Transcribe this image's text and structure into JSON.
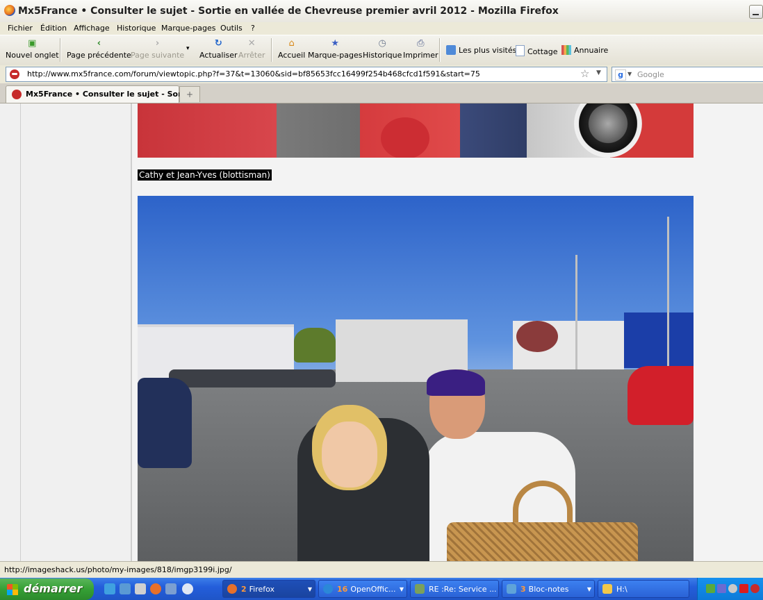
{
  "window": {
    "title": "Mx5France • Consulter le sujet - Sortie en vallée de Chevreuse premier avril 2012 - Mozilla Firefox"
  },
  "menu": [
    "Fichier",
    "Édition",
    "Affichage",
    "Historique",
    "Marque-pages",
    "Outils",
    "?"
  ],
  "toolbar": {
    "new_tab": "Nouvel onglet",
    "back": "Page précédente",
    "forward": "Page suivante",
    "reload": "Actualiser",
    "stop": "Arrêter",
    "home": "Accueil",
    "bookmarks": "Marque-pages",
    "history": "Historique",
    "print": "Imprimer"
  },
  "bookmarks_bar": [
    "Les plus visités",
    "Cottage",
    "Annuaire"
  ],
  "address": {
    "url": "http://www.mx5france.com/forum/viewtopic.php?f=37&t=13060&sid=bf85653fcc16499f254b468cfcd1f591&start=75"
  },
  "search": {
    "placeholder": "Google",
    "engine_icon": "g"
  },
  "tabs": [
    {
      "label": "Mx5France • Consulter le sujet - Sor..."
    }
  ],
  "new_tab_glyph": "+",
  "content": {
    "caption": "Cathy et Jean-Yves (blottisman)"
  },
  "status": {
    "text": "http://imageshack.us/photo/my-images/818/imgp3199i.jpg/"
  },
  "taskbar": {
    "start": "démarrer",
    "tasks": [
      {
        "num": "2",
        "label": "Firefox",
        "color": "#e8702a"
      },
      {
        "num": "16",
        "label": "OpenOffic...",
        "color": "#2b88d8"
      },
      {
        "num": "",
        "label": "RE :Re: Service ...",
        "color": "#7ba05b"
      },
      {
        "num": "3",
        "label": "Bloc-notes",
        "color": "#5fa3d9"
      },
      {
        "num": "",
        "label": "H:\\",
        "color": "#f2c84b"
      }
    ]
  },
  "colors": {
    "accent": "#245edb",
    "start_green": "#35a035"
  }
}
